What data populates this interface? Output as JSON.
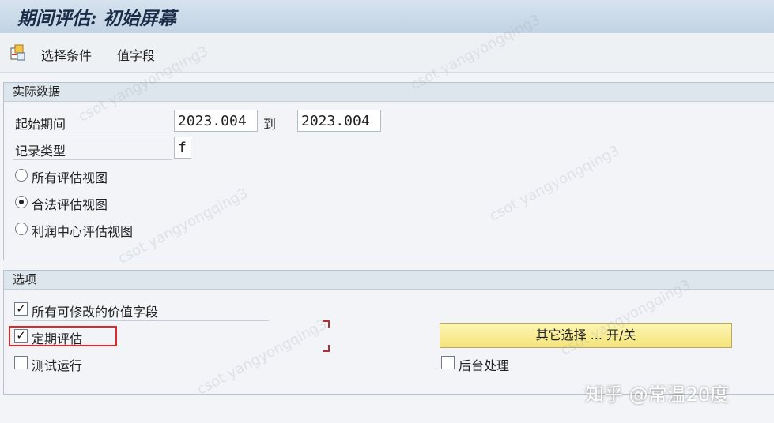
{
  "window": {
    "title": "期间评估: 初始屏幕"
  },
  "toolbar": {
    "items": [
      "选择条件",
      "值字段"
    ]
  },
  "actual_data": {
    "header": "实际数据",
    "period_start_label": "起始期间",
    "period_from": "2023.004",
    "to_label": "到",
    "period_to": "2023.004",
    "record_type_label": "记录类型",
    "record_type_value": "f",
    "views": [
      {
        "label": "所有评估视图",
        "selected": false
      },
      {
        "label": "合法评估视图",
        "selected": true
      },
      {
        "label": "利润中心评估视图",
        "selected": false
      }
    ]
  },
  "options": {
    "header": "选项",
    "checkboxes": [
      {
        "label": "所有可修改的价值字段",
        "checked": true
      },
      {
        "label": "定期评估",
        "checked": true
      },
      {
        "label": "测试运行",
        "checked": false
      },
      {
        "label": "后台处理",
        "checked": false
      }
    ],
    "more_button": "其它选择 ... 开/关"
  },
  "watermark": "csot yangyongqing3",
  "attribution": "知乎 @常温20度"
}
